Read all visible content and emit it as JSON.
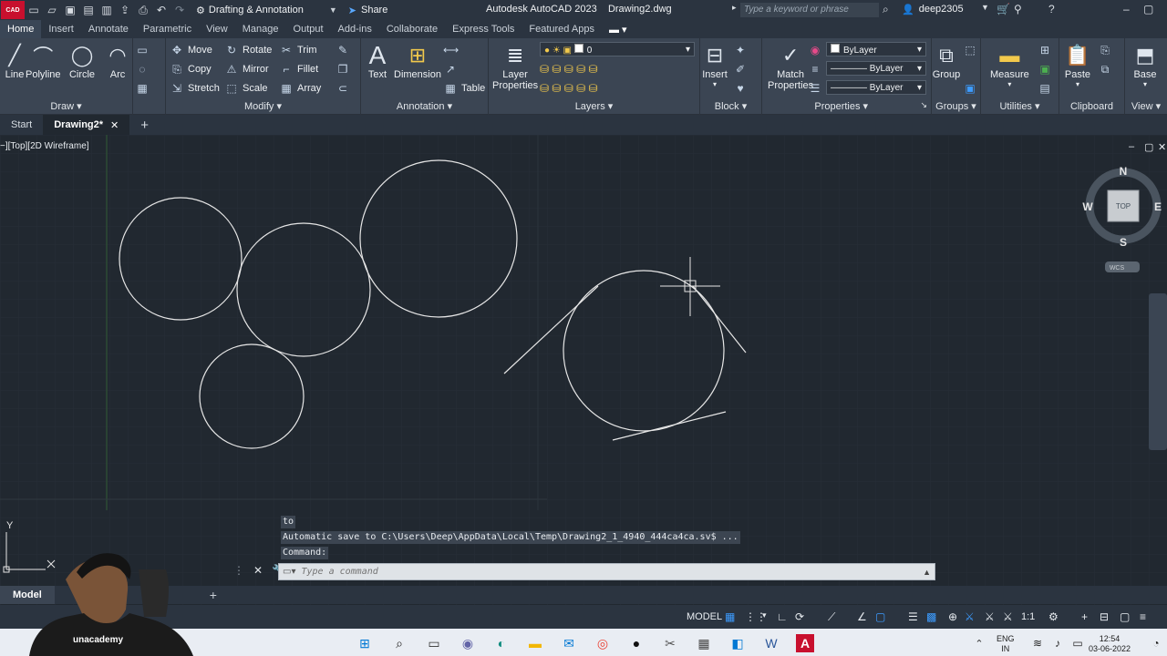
{
  "titlebar": {
    "app_logo": "CAD",
    "workspace": "Drafting & Annotation",
    "share": "Share",
    "app_name": "Autodesk AutoCAD 2023",
    "file_name": "Drawing2.dwg",
    "search_placeholder": "Type a keyword or phrase",
    "user": "deep2305"
  },
  "ribbon_tabs": [
    "Home",
    "Insert",
    "Annotate",
    "Parametric",
    "View",
    "Manage",
    "Output",
    "Add-ins",
    "Collaborate",
    "Express Tools",
    "Featured Apps"
  ],
  "ribbon": {
    "draw": {
      "title": "Draw",
      "line": "Line",
      "polyline": "Polyline",
      "circle": "Circle",
      "arc": "Arc"
    },
    "modify": {
      "title": "Modify",
      "move": "Move",
      "rotate": "Rotate",
      "trim": "Trim",
      "copy": "Copy",
      "mirror": "Mirror",
      "fillet": "Fillet",
      "stretch": "Stretch",
      "scale": "Scale",
      "array": "Array"
    },
    "annotation": {
      "title": "Annotation",
      "text": "Text",
      "dimension": "Dimension",
      "table": "Table"
    },
    "layers": {
      "title": "Layers",
      "layer_properties_1": "Layer",
      "layer_properties_2": "Properties",
      "current_layer": "0"
    },
    "block": {
      "title": "Block",
      "insert": "Insert"
    },
    "properties": {
      "title": "Properties",
      "match_1": "Match",
      "match_2": "Properties",
      "color": "ByLayer",
      "linetype": "ByLayer",
      "lineweight": "ByLayer"
    },
    "groups": {
      "title": "Groups",
      "group": "Group"
    },
    "utilities": {
      "title": "Utilities",
      "measure": "Measure"
    },
    "clipboard": {
      "title": "Clipboard",
      "paste": "Paste"
    },
    "view": {
      "title": "View",
      "base": "Base"
    }
  },
  "file_tabs": {
    "start": "Start",
    "drawing": "Drawing2*"
  },
  "viewport": {
    "label": "−][Top][2D Wireframe]"
  },
  "viewcube": {
    "n": "N",
    "s": "S",
    "e": "E",
    "w": "W",
    "face": "TOP",
    "wcs": "WCS"
  },
  "ucs": {
    "y": "Y"
  },
  "command": {
    "history": [
      "to",
      "Automatic save to C:\\Users\\Deep\\AppData\\Local\\Temp\\Drawing2_1_4940_444ca4ca.sv$ ...",
      "Command:"
    ],
    "placeholder": "Type a command"
  },
  "layout_tabs": {
    "model": "Model"
  },
  "status": {
    "model": "MODEL",
    "scale": "1:1"
  },
  "webcam": {
    "brand": "unacademy"
  },
  "tray": {
    "lang_1": "ENG",
    "lang_2": "IN",
    "time": "12:54",
    "date": "03-06-2022"
  },
  "colors": {
    "background": "#212830",
    "ribbon": "#3b4553",
    "accent": "#3d9cff",
    "logo_red": "#c8102e"
  }
}
